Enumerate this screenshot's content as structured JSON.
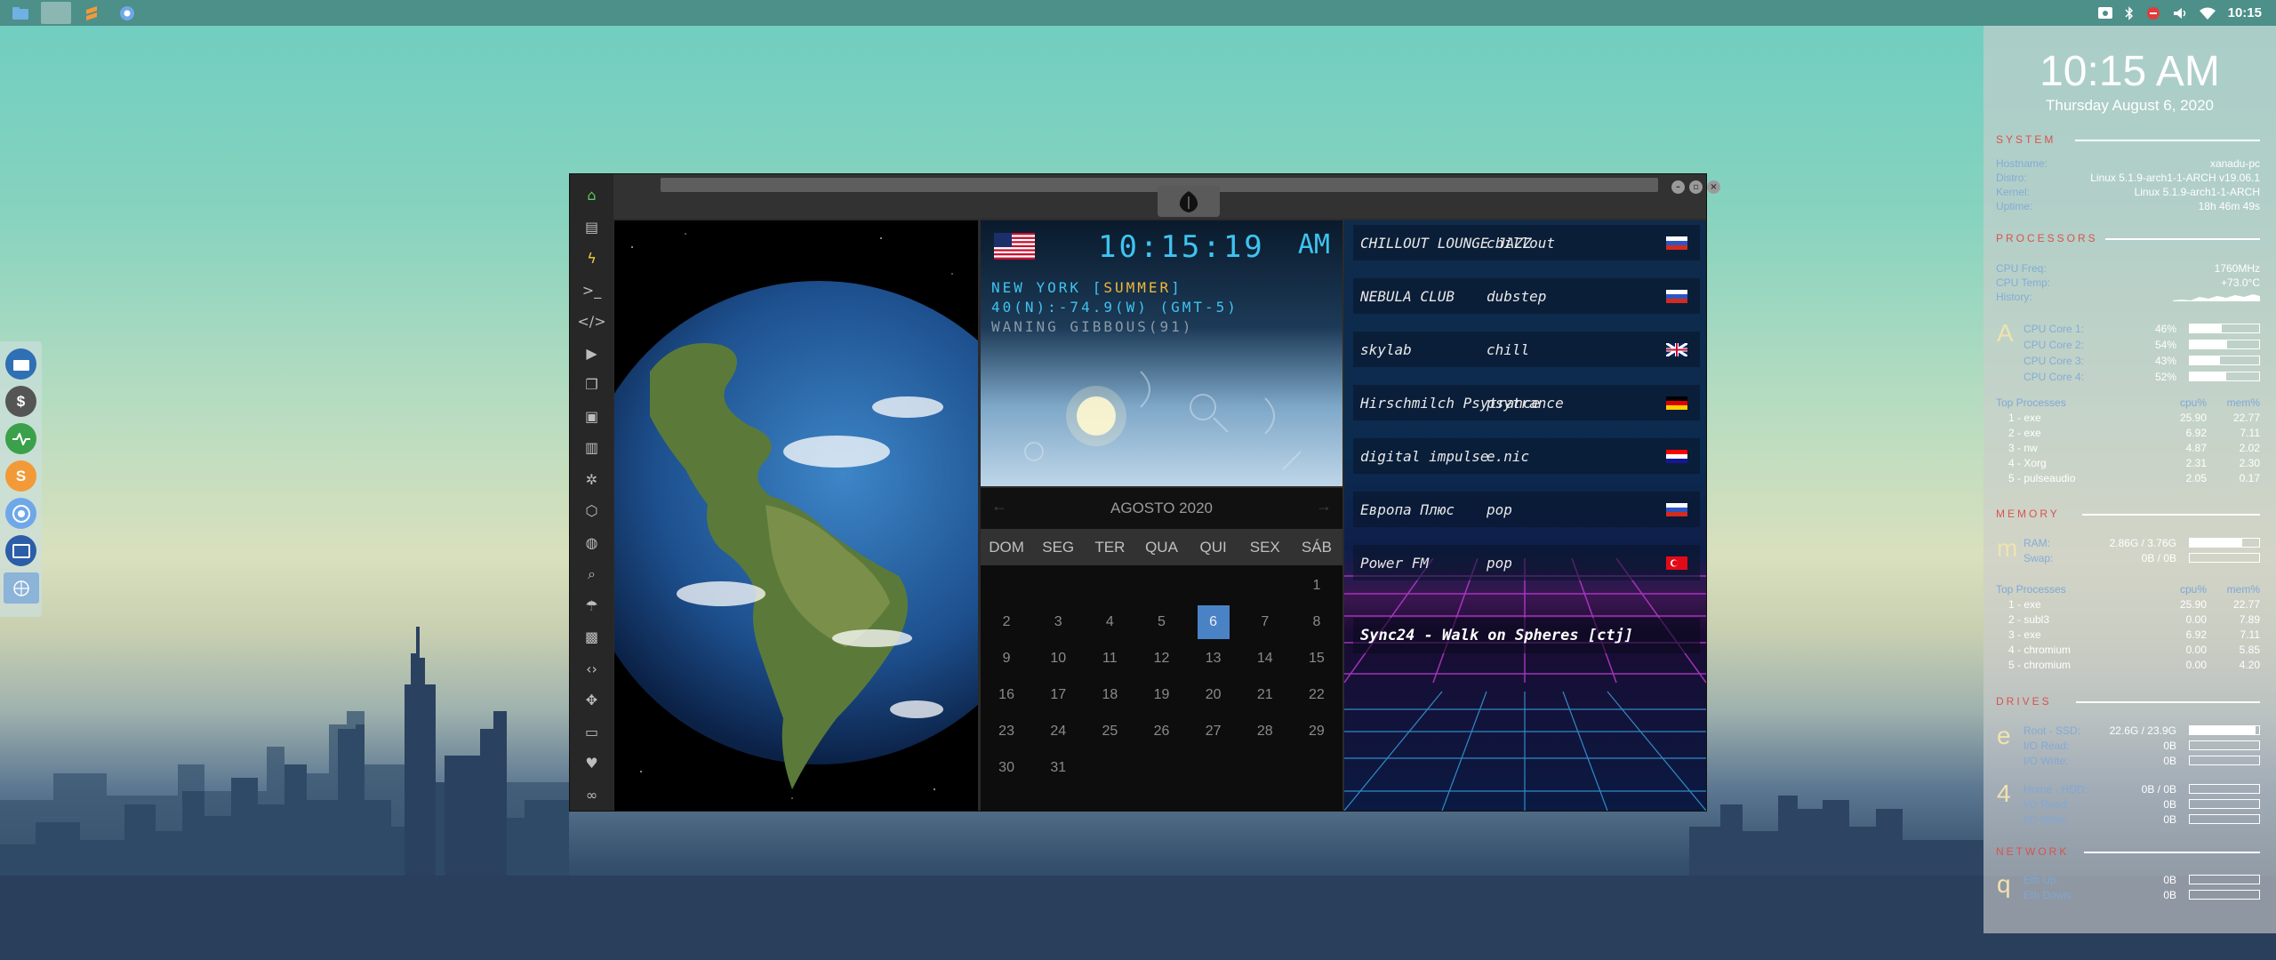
{
  "topbar": {
    "clock": "10:15"
  },
  "conky": {
    "time": "10:15 AM",
    "date": "Thursday August  6, 2020",
    "system": {
      "title": "SYSTEM",
      "rows": [
        {
          "k": "Hostname:",
          "v": "xanadu-pc"
        },
        {
          "k": "Distro:",
          "v": "Linux 5.1.9-arch1-1-ARCH v19.06.1"
        },
        {
          "k": "Kernel:",
          "v": "Linux 5.1.9-arch1-1-ARCH"
        },
        {
          "k": "Uptime:",
          "v": "18h 46m 49s"
        }
      ]
    },
    "processors": {
      "title": "PROCESSORS",
      "rows": [
        {
          "k": "CPU Freq:",
          "v": "1760MHz"
        },
        {
          "k": "CPU Temp:",
          "v": "+73.0°C"
        },
        {
          "k": "History:",
          "v": ""
        }
      ],
      "letter": "A",
      "cores": [
        {
          "k": "CPU Core 1:",
          "v": "46%",
          "pct": 46
        },
        {
          "k": "CPU Core 2:",
          "v": "54%",
          "pct": 54
        },
        {
          "k": "CPU Core 3:",
          "v": "43%",
          "pct": 43
        },
        {
          "k": "CPU Core 4:",
          "v": "52%",
          "pct": 52
        }
      ],
      "top_header": {
        "name": "Top Processes",
        "c1": "cpu%",
        "c2": "mem%"
      },
      "top": [
        {
          "n": "1 - exe",
          "c1": "25.90",
          "c2": "22.77"
        },
        {
          "n": "2 - exe",
          "c1": "6.92",
          "c2": "7.11"
        },
        {
          "n": "3 - nw",
          "c1": "4.87",
          "c2": "2.02"
        },
        {
          "n": "4 - Xorg",
          "c1": "2.31",
          "c2": "2.30"
        },
        {
          "n": "5 - pulseaudio",
          "c1": "2.05",
          "c2": "0.17"
        }
      ]
    },
    "memory": {
      "title": "MEMORY",
      "letter": "m",
      "rows": [
        {
          "k": "RAM:",
          "v": "2.86G / 3.76G",
          "pct": 76
        },
        {
          "k": "Swap:",
          "v": "0B / 0B",
          "pct": 0
        }
      ],
      "top_header": {
        "name": "Top Processes",
        "c1": "cpu%",
        "c2": "mem%"
      },
      "top": [
        {
          "n": "1 - exe",
          "c1": "25.90",
          "c2": "22.77"
        },
        {
          "n": "2 - subl3",
          "c1": "0.00",
          "c2": "7.89"
        },
        {
          "n": "3 - exe",
          "c1": "6.92",
          "c2": "7.11"
        },
        {
          "n": "4 - chromium",
          "c1": "0.00",
          "c2": "5.85"
        },
        {
          "n": "5 - chromium",
          "c1": "0.00",
          "c2": "4.20"
        }
      ]
    },
    "drives": {
      "title": "DRIVES",
      "d1": {
        "letter": "e",
        "rows": [
          {
            "k": "Root - SSD:",
            "v": "22.6G / 23.9G",
            "pct": 95
          },
          {
            "k": "I/O Read:",
            "v": "0B",
            "pct": 0
          },
          {
            "k": "I/O Write:",
            "v": "0B",
            "pct": 0
          }
        ]
      },
      "d2": {
        "letter": "4",
        "rows": [
          {
            "k": "Home - HDD:",
            "v": "0B / 0B",
            "pct": 0
          },
          {
            "k": "I/O Read:",
            "v": "0B",
            "pct": 0
          },
          {
            "k": "I/O Write:",
            "v": "0B",
            "pct": 0
          }
        ]
      }
    },
    "network": {
      "title": "NETWORK",
      "letter": "q",
      "rows": [
        {
          "k": "Eth Up:",
          "v": "0B",
          "pct": 0
        },
        {
          "k": "Eth Down:",
          "v": "0B",
          "pct": 0
        }
      ]
    }
  },
  "clock": {
    "time": "10:15:19",
    "ampm": "AM",
    "city": "NEW YORK",
    "season": "SUMMER",
    "coords": "40(N):-74.9(W) (GMT-5)",
    "moon": "WANING GIBBOUS(91)"
  },
  "calendar": {
    "month": "AGOSTO 2020",
    "prev": "←",
    "next": "→",
    "days_of_week": [
      "DOM",
      "SEG",
      "TER",
      "QUA",
      "QUI",
      "SEX",
      "SÁB"
    ],
    "first_weekday": 6,
    "num_days": 31,
    "today": 6
  },
  "radio": {
    "stations": [
      {
        "name": "CHILLOUT LOUNGE JAZZ",
        "genre": "chillout",
        "flag": "ru"
      },
      {
        "name": "NEBULA CLUB",
        "genre": "dubstep",
        "flag": "ru"
      },
      {
        "name": "skylab",
        "genre": "chill",
        "flag": "gb"
      },
      {
        "name": "Hirschmilch Psytrance",
        "genre": "psytrance",
        "flag": "de"
      },
      {
        "name": "digital impulse",
        "genre": "e.nic",
        "flag": "hr"
      },
      {
        "name": "Европа Плюс",
        "genre": "pop",
        "flag": "ru"
      },
      {
        "name": "Power FM",
        "genre": "pop",
        "flag": "tr"
      }
    ],
    "now_playing": "Sync24 - Walk on Spheres [ctj]"
  }
}
